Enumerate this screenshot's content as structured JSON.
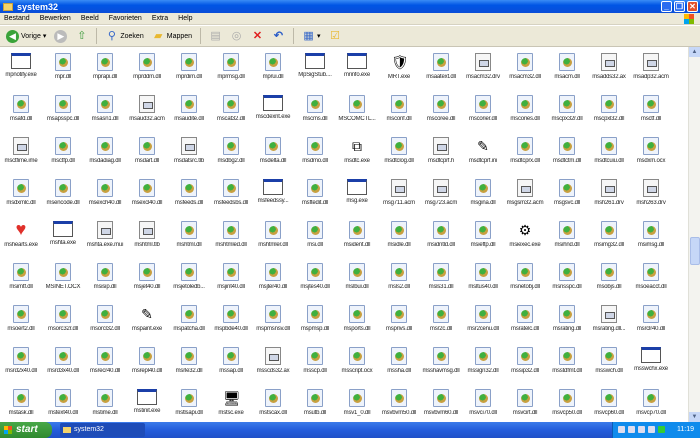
{
  "window": {
    "title": "system32"
  },
  "menu": [
    "Bestand",
    "Bewerken",
    "Beeld",
    "Favorieten",
    "Extra",
    "Help"
  ],
  "toolbar": {
    "back": "Vorige",
    "search": "Zoeken",
    "folders": "Mappen"
  },
  "taskbar": {
    "start": "start",
    "task": "system32",
    "clock": "11:19"
  },
  "files": [
    [
      [
        "mpnotify.exe",
        "exe"
      ],
      [
        "mpr.dll",
        "dll"
      ],
      [
        "mprapi.dll",
        "dll"
      ],
      [
        "mprddm.dll",
        "dll"
      ],
      [
        "mprdim.dll",
        "dll"
      ],
      [
        "mprmsg.dll",
        "dll"
      ],
      [
        "mprui.dll",
        "dll"
      ],
      [
        "MpSigStub....",
        "exe"
      ],
      [
        "mrinfo.exe",
        "exe"
      ],
      [
        "MRT.exe",
        "mrt"
      ],
      [
        "msaatext.dll",
        "dll"
      ],
      [
        "msacm32.drv",
        "sys"
      ],
      [
        "msacm32.dll",
        "dll"
      ],
      [
        "msacm.dll",
        "dll"
      ],
      [
        "msadds32.ax",
        "sys"
      ],
      [
        "msadp32.acm",
        "sys"
      ]
    ],
    [
      [
        "msafd.dll",
        "dll"
      ],
      [
        "msapsspc.dll",
        "dll"
      ],
      [
        "msasn1.dll",
        "dll"
      ],
      [
        "msaud32.acm",
        "sys"
      ],
      [
        "msaudite.dll",
        "dll"
      ],
      [
        "mscat32.dll",
        "dll"
      ],
      [
        "mscdexnt.exe",
        "exe"
      ],
      [
        "mscms.dll",
        "dll"
      ],
      [
        "MSCOMCTL...",
        "dll"
      ],
      [
        "msconf.dll",
        "dll"
      ],
      [
        "mscoree.dll",
        "dll"
      ],
      [
        "mscorier.dll",
        "dll"
      ],
      [
        "mscories.dll",
        "dll"
      ],
      [
        "mscpx32r.dll",
        "dll"
      ],
      [
        "mscpxl32.dll",
        "dll"
      ],
      [
        "msctf.dll",
        "dll"
      ]
    ],
    [
      [
        "msctfime.ime",
        "sys"
      ],
      [
        "msctfp.dll",
        "dll"
      ],
      [
        "msdadiag.dll",
        "dll"
      ],
      [
        "msdart.dll",
        "dll"
      ],
      [
        "msdatsrc.tlb",
        "sys"
      ],
      [
        "msdbg2.dll",
        "dll"
      ],
      [
        "msdelta.dll",
        "dll"
      ],
      [
        "msdmo.dll",
        "dll"
      ],
      [
        "msdtc.exe",
        "msdtc"
      ],
      [
        "msdtclog.dll",
        "dll"
      ],
      [
        "msdtcprf.h",
        "sys"
      ],
      [
        "msdtcprf.ini",
        "ini"
      ],
      [
        "msdtcprx.dll",
        "dll"
      ],
      [
        "msdtctm.dll",
        "dll"
      ],
      [
        "msdtcuiu.dll",
        "dll"
      ],
      [
        "msdxm.ocx",
        "dll"
      ]
    ],
    [
      [
        "msdxmlc.dll",
        "dll"
      ],
      [
        "msencode.dll",
        "dll"
      ],
      [
        "msexch40.dll",
        "dll"
      ],
      [
        "msexcl40.dll",
        "dll"
      ],
      [
        "msfeeds.dll",
        "dll"
      ],
      [
        "msfeedsbs.dll",
        "dll"
      ],
      [
        "msfeedssy...",
        "exe"
      ],
      [
        "msftedit.dll",
        "dll"
      ],
      [
        "msg.exe",
        "exe"
      ],
      [
        "msg711.acm",
        "sys"
      ],
      [
        "msg723.acm",
        "sys"
      ],
      [
        "msgina.dll",
        "dll"
      ],
      [
        "msgsm32.acm",
        "sys"
      ],
      [
        "msgsvc.dll",
        "dll"
      ],
      [
        "msh261.drv",
        "sys"
      ],
      [
        "msh263.drv",
        "sys"
      ]
    ],
    [
      [
        "mshearts.exe",
        "heart"
      ],
      [
        "mshta.exe",
        "exe"
      ],
      [
        "mshta.exe.mui",
        "sys"
      ],
      [
        "mshtml.tlb",
        "sys"
      ],
      [
        "mshtml.dll",
        "dll"
      ],
      [
        "mshtmled.dll",
        "dll"
      ],
      [
        "mshtmler.dll",
        "dll"
      ],
      [
        "msi.dll",
        "dll"
      ],
      [
        "msident.dll",
        "dll"
      ],
      [
        "msidle.dll",
        "dll"
      ],
      [
        "msidntld.dll",
        "dll"
      ],
      [
        "msieftp.dll",
        "dll"
      ],
      [
        "msiexec.exe",
        "msiexec"
      ],
      [
        "msihnd.dll",
        "dll"
      ],
      [
        "msimg32.dll",
        "dll"
      ],
      [
        "msimsg.dll",
        "dll"
      ]
    ],
    [
      [
        "msimtf.dll",
        "dll"
      ],
      [
        "MSINET.OCX",
        "dll"
      ],
      [
        "msisip.dll",
        "dll"
      ],
      [
        "msjet40.dll",
        "dll"
      ],
      [
        "msjetoledb...",
        "dll"
      ],
      [
        "msjint40.dll",
        "dll"
      ],
      [
        "msjter40.dll",
        "dll"
      ],
      [
        "msjtes40.dll",
        "dll"
      ],
      [
        "mslbui.dll",
        "dll"
      ],
      [
        "msls2.dll",
        "dll"
      ],
      [
        "msls31.dll",
        "dll"
      ],
      [
        "msltus40.dll",
        "dll"
      ],
      [
        "msnetobj.dll",
        "dll"
      ],
      [
        "msnsspc.dll",
        "dll"
      ],
      [
        "msobjs.dll",
        "dll"
      ],
      [
        "msoeacct.dll",
        "dll"
      ]
    ],
    [
      [
        "msoert2.dll",
        "dll"
      ],
      [
        "msorc32r.dll",
        "dll"
      ],
      [
        "msorcl32.dll",
        "dll"
      ],
      [
        "mspaint.exe",
        "mspaint"
      ],
      [
        "mspatcha.dll",
        "dll"
      ],
      [
        "mspbde40.dll",
        "dll"
      ],
      [
        "mspmsnsv.dll",
        "dll"
      ],
      [
        "mspmsp.dll",
        "dll"
      ],
      [
        "msports.dll",
        "dll"
      ],
      [
        "msprivs.dll",
        "dll"
      ],
      [
        "msr2c.dll",
        "dll"
      ],
      [
        "msr2cenu.dll",
        "dll"
      ],
      [
        "msratelc.dll",
        "dll"
      ],
      [
        "msrating.dll",
        "dll"
      ],
      [
        "msrating.dll...",
        "sys"
      ],
      [
        "msrclr40.dll",
        "dll"
      ]
    ],
    [
      [
        "msrd2x40.dll",
        "dll"
      ],
      [
        "msrd3x40.dll",
        "dll"
      ],
      [
        "msrecr40.dll",
        "dll"
      ],
      [
        "msrepl40.dll",
        "dll"
      ],
      [
        "msrle32.dll",
        "dll"
      ],
      [
        "mssap.dll",
        "dll"
      ],
      [
        "msscds32.ax",
        "sys"
      ],
      [
        "msscp.dll",
        "dll"
      ],
      [
        "msscript.ocx",
        "dll"
      ],
      [
        "mssha.dll",
        "dll"
      ],
      [
        "msshavmsg.dll",
        "dll"
      ],
      [
        "mssign32.dll",
        "dll"
      ],
      [
        "mssip32.dll",
        "dll"
      ],
      [
        "msstdfmt.dll",
        "dll"
      ],
      [
        "msswch.dll",
        "dll"
      ],
      [
        "msswchx.exe",
        "exe"
      ]
    ],
    [
      [
        "mstask.dll",
        "dll"
      ],
      [
        "mstext40.dll",
        "dll"
      ],
      [
        "mstime.dll",
        "dll"
      ],
      [
        "mstinit.exe",
        "exe"
      ],
      [
        "mstlsapi.dll",
        "dll"
      ],
      [
        "mstsc.exe",
        "mstsc"
      ],
      [
        "mstscax.dll",
        "dll"
      ],
      [
        "msutb.dll",
        "dll"
      ],
      [
        "msv1_0.dll",
        "dll"
      ],
      [
        "msvbvm50.dll",
        "dll"
      ],
      [
        "msvbvm60.dll",
        "dll"
      ],
      [
        "msvci70.dll",
        "dll"
      ],
      [
        "msvcirt.dll",
        "dll"
      ],
      [
        "msvcp50.dll",
        "dll"
      ],
      [
        "msvcp60.dll",
        "dll"
      ],
      [
        "msvcp70.dll",
        "dll"
      ]
    ]
  ]
}
